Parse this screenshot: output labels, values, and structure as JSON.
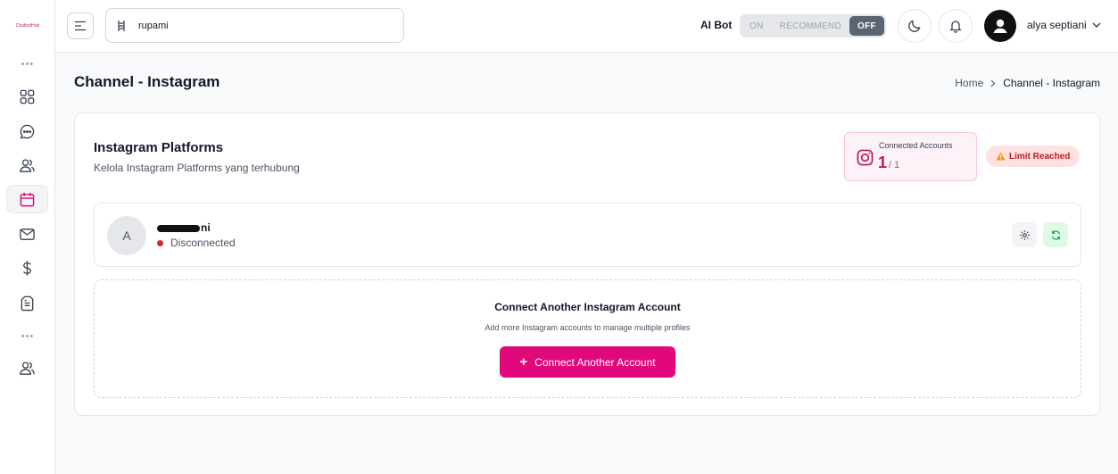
{
  "sidebar": {
    "logo_text": "ChatbotHub"
  },
  "header": {
    "search_value": "rupami",
    "ai_bot_label": "AI Bot",
    "ai_bot_options": [
      "ON",
      "RECOMMEND",
      "OFF"
    ],
    "ai_bot_selected": "OFF",
    "username": "alya septiani"
  },
  "page": {
    "title": "Channel - Instagram",
    "breadcrumb": [
      "Home",
      "Channel - Instagram"
    ]
  },
  "card": {
    "title": "Instagram Platforms",
    "subtitle": "Kelola Instagram Platforms yang terhubung",
    "connected_label": "Connected Accounts",
    "connected_count": "1",
    "connected_total": "/ 1",
    "limit_badge": "Limit Reached"
  },
  "account": {
    "avatar_initial": "A",
    "name_visible": "ni",
    "status": "Disconnected"
  },
  "connect": {
    "title": "Connect Another Instagram Account",
    "subtitle": "Add more Instagram accounts to manage multiple profiles",
    "button_label": "Connect Another Account"
  },
  "colors": {
    "accent": "#e0087a",
    "status_disconnected": "#dc2626",
    "limit_text": "#b91c1c"
  }
}
